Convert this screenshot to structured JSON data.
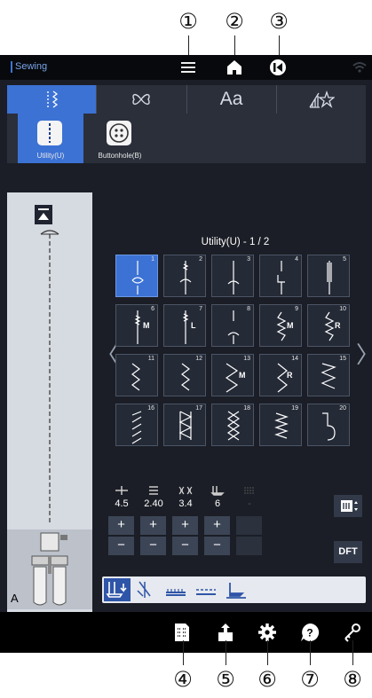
{
  "callouts": [
    "①",
    "②",
    "③",
    "④",
    "⑤",
    "⑥",
    "⑦",
    "⑧"
  ],
  "status_bar": {
    "app_name": "Sewing",
    "icons": [
      "menu-icon",
      "home-icon",
      "back-icon",
      "wifi-icon"
    ]
  },
  "category_tabs": [
    {
      "icon": "utility-stitch-icon",
      "label": "",
      "active": true
    },
    {
      "icon": "decorative-stitch-icon",
      "label": "",
      "active": false
    },
    {
      "icon": "alphabet-icon",
      "label": "Aa",
      "active": false
    },
    {
      "icon": "favorites-icon",
      "label": "",
      "active": false
    }
  ],
  "subcategories": [
    {
      "label": "Utility(U)",
      "icon": "straight-stitch-icon",
      "selected": true
    },
    {
      "label": "Buttonhole(B)",
      "icon": "button-icon",
      "selected": false
    }
  ],
  "preview": {
    "presser_foot": "A"
  },
  "stitch_panel": {
    "title": "Utility(U) - 1 / 2",
    "stitches": [
      {
        "num": "1",
        "sub": "",
        "selected": true
      },
      {
        "num": "2",
        "sub": ""
      },
      {
        "num": "3",
        "sub": ""
      },
      {
        "num": "4",
        "sub": ""
      },
      {
        "num": "5",
        "sub": ""
      },
      {
        "num": "6",
        "sub": "M"
      },
      {
        "num": "7",
        "sub": "L"
      },
      {
        "num": "8",
        "sub": ""
      },
      {
        "num": "9",
        "sub": "M"
      },
      {
        "num": "10",
        "sub": "R"
      },
      {
        "num": "11",
        "sub": ""
      },
      {
        "num": "12",
        "sub": ""
      },
      {
        "num": "13",
        "sub": "M"
      },
      {
        "num": "14",
        "sub": "R"
      },
      {
        "num": "15",
        "sub": ""
      },
      {
        "num": "16",
        "sub": ""
      },
      {
        "num": "17",
        "sub": ""
      },
      {
        "num": "18",
        "sub": ""
      },
      {
        "num": "19",
        "sub": ""
      },
      {
        "num": "20",
        "sub": ""
      }
    ]
  },
  "parameters": [
    {
      "icon": "needle-position-icon",
      "value": "4.5",
      "enabled": true
    },
    {
      "icon": "stitch-length-icon",
      "value": "2.40",
      "enabled": true
    },
    {
      "icon": "thread-tension-icon",
      "value": "3.4",
      "enabled": true
    },
    {
      "icon": "presser-foot-pressure-icon",
      "value": "6",
      "enabled": true
    },
    {
      "icon": "feed-icon",
      "value": "-",
      "enabled": false
    }
  ],
  "buttons": {
    "dft": "DFT",
    "plus": "+",
    "minus": "−"
  },
  "bottom_icons": [
    "stitch-memory-icon",
    "export-icon",
    "settings-icon",
    "help-icon",
    "key-icon"
  ]
}
